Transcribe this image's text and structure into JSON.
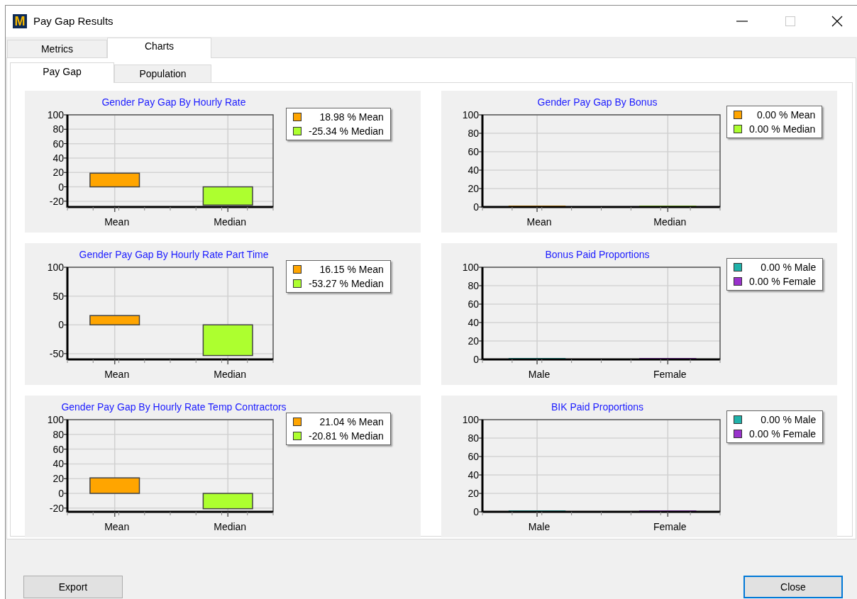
{
  "window": {
    "title": "Pay Gap Results",
    "logo_text": "M",
    "maximize_disabled": true
  },
  "tabs": [
    {
      "label": "Metrics",
      "selected": false
    },
    {
      "label": "Charts",
      "selected": true
    }
  ],
  "subtabs": [
    {
      "label": "Pay Gap",
      "selected": true
    },
    {
      "label": "Population",
      "selected": false
    }
  ],
  "charts": [
    {
      "legend": [
        {
          "label": "18.98 % Mean",
          "color": "#ffa500"
        },
        {
          "label": "-25.34 % Median",
          "color": "#adff2f"
        }
      ],
      "chart_data": {
        "type": "bar",
        "title": "Gender Pay Gap By Hourly Rate",
        "categories": [
          "Mean",
          "Median"
        ],
        "values": [
          18.98,
          -25.34
        ],
        "ylim": [
          -28,
          100
        ],
        "yticks": [
          -20,
          0,
          20,
          40,
          60,
          80,
          100
        ],
        "grid": true
      }
    },
    {
      "legend": [
        {
          "label": "0.00 % Mean",
          "color": "#ffa500"
        },
        {
          "label": "0.00 % Median",
          "color": "#adff2f"
        }
      ],
      "chart_data": {
        "type": "bar",
        "title": "Gender Pay Gap By Bonus",
        "categories": [
          "Mean",
          "Median"
        ],
        "values": [
          0,
          0
        ],
        "ylim": [
          0,
          100
        ],
        "yticks": [
          0,
          20,
          40,
          60,
          80,
          100
        ],
        "grid": true
      }
    },
    {
      "legend": [
        {
          "label": "16.15 % Mean",
          "color": "#ffa500"
        },
        {
          "label": "-53.27 % Median",
          "color": "#adff2f"
        }
      ],
      "chart_data": {
        "type": "bar",
        "title": "Gender Pay Gap By Hourly Rate Part Time",
        "categories": [
          "Mean",
          "Median"
        ],
        "values": [
          16.15,
          -53.27
        ],
        "ylim": [
          -60,
          100
        ],
        "yticks": [
          -50,
          0,
          50,
          100
        ],
        "grid": true
      }
    },
    {
      "legend": [
        {
          "label": "0.00 % Male",
          "color": "#20b2aa"
        },
        {
          "label": "0.00 % Female",
          "color": "#9932cc"
        }
      ],
      "chart_data": {
        "type": "bar",
        "title": "Bonus Paid Proportions",
        "categories": [
          "Male",
          "Female"
        ],
        "values": [
          0,
          0
        ],
        "ylim": [
          0,
          100
        ],
        "yticks": [
          0,
          20,
          40,
          60,
          80,
          100
        ],
        "grid": true
      }
    },
    {
      "legend": [
        {
          "label": "21.04 % Mean",
          "color": "#ffa500"
        },
        {
          "label": "-20.81 % Median",
          "color": "#adff2f"
        }
      ],
      "chart_data": {
        "type": "bar",
        "title": "Gender Pay Gap By Hourly Rate Temp Contractors",
        "categories": [
          "Mean",
          "Median"
        ],
        "values": [
          21.04,
          -20.81
        ],
        "ylim": [
          -25,
          100
        ],
        "yticks": [
          -20,
          0,
          20,
          40,
          60,
          80,
          100
        ],
        "grid": true
      }
    },
    {
      "legend": [
        {
          "label": "0.00 % Male",
          "color": "#20b2aa"
        },
        {
          "label": "0.00 % Female",
          "color": "#9932cc"
        }
      ],
      "chart_data": {
        "type": "bar",
        "title": "BIK Paid Proportions",
        "categories": [
          "Male",
          "Female"
        ],
        "values": [
          0,
          0
        ],
        "ylim": [
          0,
          100
        ],
        "yticks": [
          0,
          20,
          40,
          60,
          80,
          100
        ],
        "grid": true
      }
    }
  ],
  "buttons": [
    {
      "label": "Export",
      "focused": false
    },
    {
      "label": "Close",
      "focused": true
    }
  ]
}
